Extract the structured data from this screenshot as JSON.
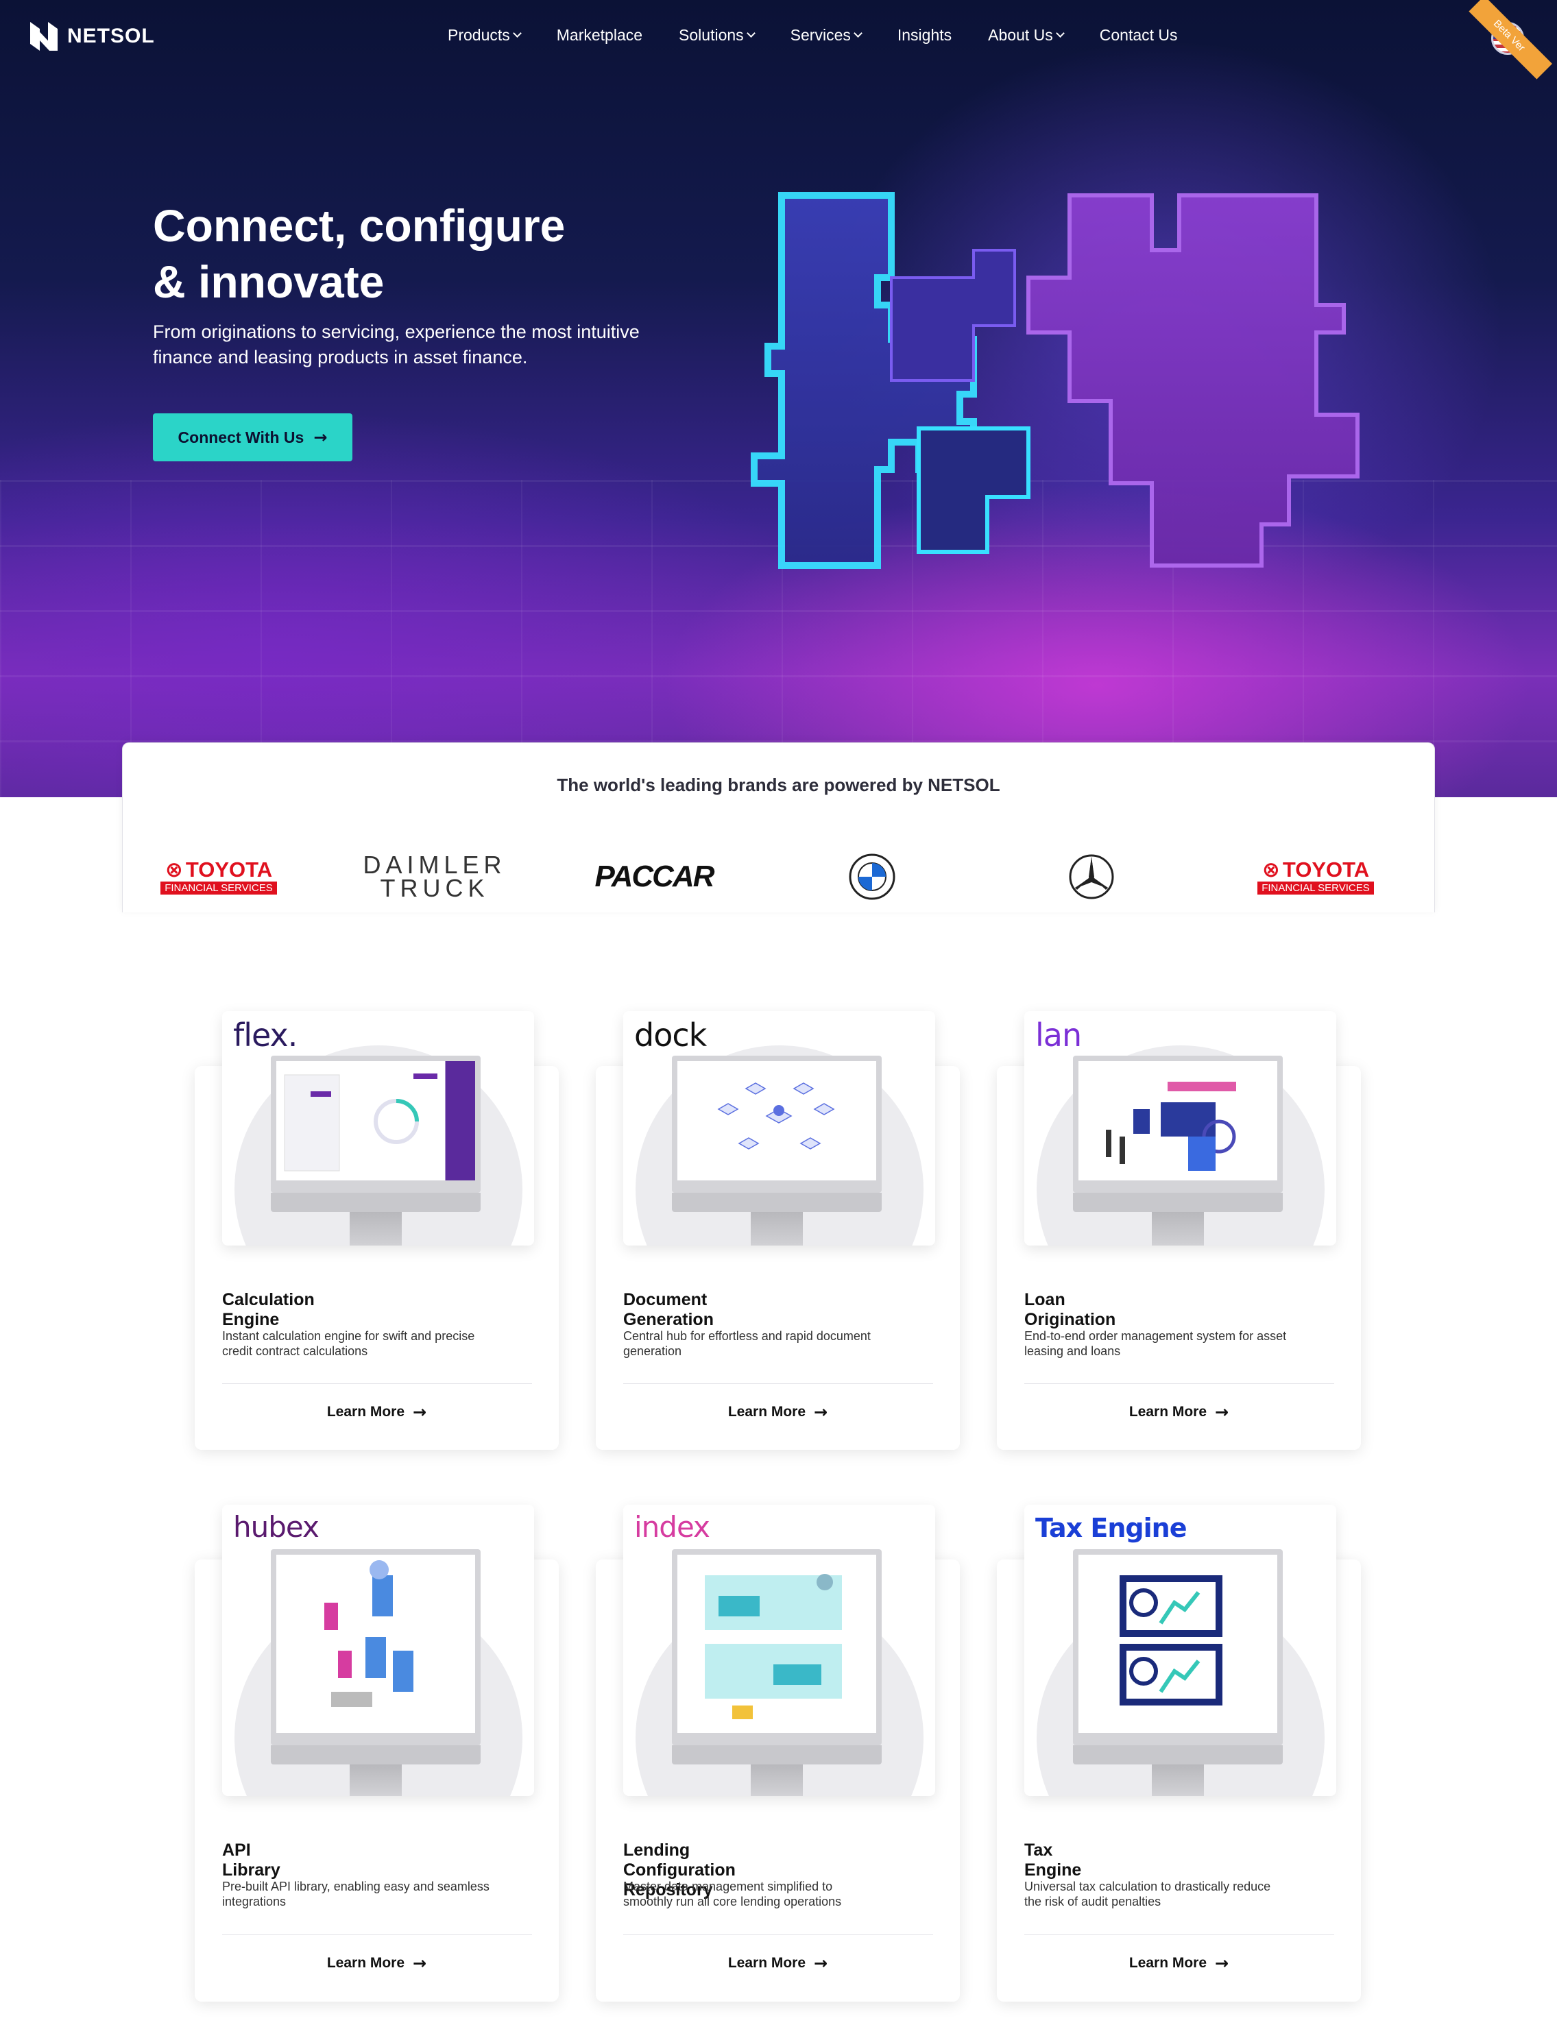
{
  "header": {
    "logo_text": "NETSOL",
    "menu": [
      {
        "label": "Products",
        "dropdown": true
      },
      {
        "label": "Marketplace",
        "dropdown": false
      },
      {
        "label": "Solutions",
        "dropdown": true
      },
      {
        "label": "Services",
        "dropdown": true
      },
      {
        "label": "Insights",
        "dropdown": false
      },
      {
        "label": "About Us",
        "dropdown": true
      },
      {
        "label": "Contact Us",
        "dropdown": false
      }
    ],
    "language_icon": "us-flag-icon",
    "ribbon": "Beta Ver"
  },
  "hero": {
    "title_line1": "Connect, configure",
    "title_line2": "& innovate",
    "subtitle_line1": "From originations to servicing, experience the most intuitive",
    "subtitle_line2": "finance and leasing products in asset finance.",
    "cta": "Connect With Us"
  },
  "brands": {
    "title": "The world's leading brands are powered by NETSOL",
    "logos": [
      {
        "name": "TOYOTA",
        "sub": "FINANCIAL SERVICES"
      },
      {
        "line1": "DAIMLER",
        "line2": "TRUCK"
      },
      {
        "name": "PACCAR"
      },
      {
        "name": "BMW"
      },
      {
        "name": "Mercedes-Benz"
      },
      {
        "name": "TOYOTA",
        "sub": "FINANCIAL SERVICES"
      }
    ]
  },
  "products": [
    {
      "brand": "flex.",
      "title": "Calculation Engine",
      "desc1": "Instant calculation engine for swift and precise",
      "desc2": "credit contract calculations",
      "link": "Learn More",
      "color": "#2a1a5e"
    },
    {
      "brand": "dock",
      "title": "Document Generation",
      "desc1": "Central hub for effortless and rapid document",
      "desc2": "generation",
      "link": "Learn More",
      "color": "#111111"
    },
    {
      "brand": "lan",
      "title": "Loan Origination",
      "desc1": "End-to-end order management system for asset",
      "desc2": "leasing and loans",
      "link": "Learn More",
      "color": "#7b2fd6"
    },
    {
      "brand": "hubex",
      "title": "API Library",
      "desc1": "Pre-built API library, enabling easy and seamless",
      "desc2": "integrations",
      "link": "Learn More",
      "color": "#5a1a6e"
    },
    {
      "brand": "index",
      "title": "Lending Configuration Repository",
      "desc1": "Master data management simplified to",
      "desc2": "smoothly run all core lending operations",
      "link": "Learn More",
      "color": "#d63ca0"
    },
    {
      "brand": "Tax Engine",
      "title": "Tax Engine",
      "desc1": "Universal tax calculation to drastically reduce",
      "desc2": "the risk of audit penalties",
      "link": "Learn More",
      "color": "#1a3fd6"
    }
  ]
}
